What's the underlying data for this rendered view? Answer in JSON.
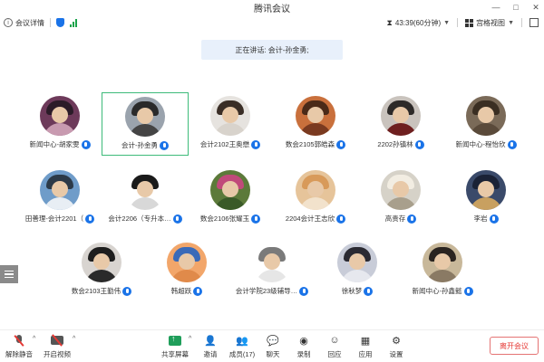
{
  "window": {
    "title": "腾讯会议",
    "controls": [
      "—",
      "□",
      "✕"
    ]
  },
  "infobar": {
    "meeting_info": "会议详情",
    "timer": "43:39(60分钟)",
    "view": "宫格视图"
  },
  "speaking": {
    "text": "正在讲话: 会计-孙金勇;"
  },
  "participants": [
    {
      "name": "新闻中心-胡家雯",
      "colors": [
        "#6d3a5a",
        "#2b1c28",
        "#c89ab0"
      ]
    },
    {
      "name": "会计-孙金勇",
      "colors": [
        "#9aa3ad",
        "#2a2a2a",
        "#444"
      ]
    },
    {
      "name": "会计2102王奥懋",
      "colors": [
        "#e6e3df",
        "#3a2e26",
        "#d8d3cc"
      ]
    },
    {
      "name": "数会2105郭皓森",
      "colors": [
        "#c9703c",
        "#4a2a18",
        "#7a3a20"
      ]
    },
    {
      "name": "2202孙镇林",
      "colors": [
        "#c9c3bd",
        "#2d2a28",
        "#6e1f1f"
      ]
    },
    {
      "name": "新闻中心-程怡欣",
      "colors": [
        "#7a6a58",
        "#3a2e22",
        "#5a4a3a"
      ]
    },
    {
      "name": "田善理-会计2201（",
      "colors": [
        "#6f9cc9",
        "#2c3a48",
        "#e8eef4"
      ]
    },
    {
      "name": "会计2206（专升本…",
      "colors": [
        "#ffffff",
        "#1a1a1a",
        "#d8d8d8"
      ]
    },
    {
      "name": "数会2106张耀玉",
      "colors": [
        "#5c7a3a",
        "#c04a7a",
        "#3a5a28"
      ]
    },
    {
      "name": "2204会计王志欣",
      "colors": [
        "#e6c49a",
        "#d89a5a",
        "#f2e2cc"
      ]
    },
    {
      "name": "高贵存",
      "colors": [
        "#d6d2c8",
        "#f2ede2",
        "#a89f8c"
      ]
    },
    {
      "name": "李岩",
      "colors": [
        "#3a4a6a",
        "#1a2236",
        "#c8a060"
      ]
    },
    {
      "name": "数会2103王勤伟",
      "colors": [
        "#d8d4d0",
        "#1e1e1e",
        "#2a2a2a"
      ]
    },
    {
      "name": "韩超跃",
      "colors": [
        "#f2a66a",
        "#3a6ab8",
        "#e08a4a"
      ]
    },
    {
      "name": "会计学院23级辅导…",
      "colors": [
        "#ffffff",
        "#7a7a7a",
        "#e6e6e6"
      ]
    },
    {
      "name": "徐秋梦",
      "colors": [
        "#c8ccd8",
        "#2a2a32",
        "#e6e8ee"
      ]
    },
    {
      "name": "新闻中心-孙鑫懿",
      "colors": [
        "#c8b89a",
        "#2a2420",
        "#8a7a64"
      ]
    }
  ],
  "toolbar": {
    "mute": "解除静音",
    "video": "开启视频",
    "share": "共享屏幕",
    "invite": "邀请",
    "members": "成员(17)",
    "chat": "聊天",
    "record": "录制",
    "react": "回应",
    "apps": "应用",
    "settings": "设置",
    "leave": "离开会议"
  },
  "colors": {
    "accent": "#1a73e8",
    "active_border": "#3dbb7a",
    "leave": "#e53935",
    "banner_bg": "#e8f0fb"
  }
}
